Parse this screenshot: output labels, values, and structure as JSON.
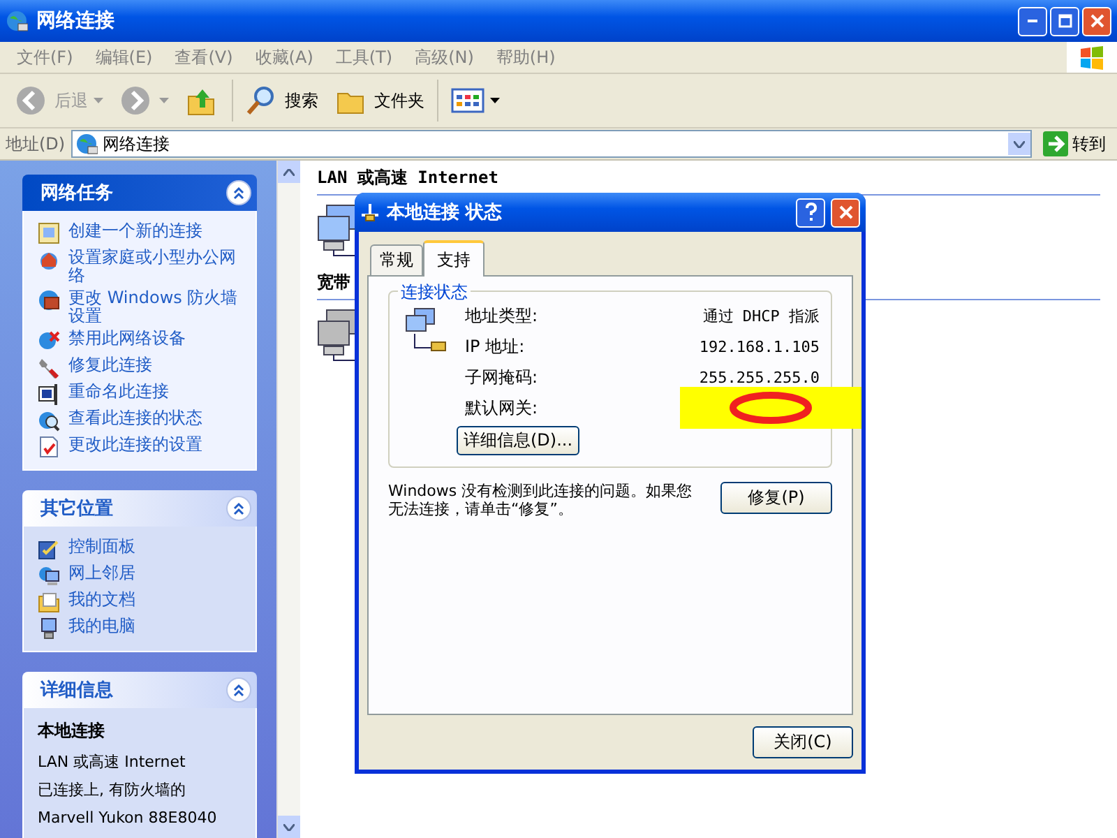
{
  "window": {
    "title": "网络连接"
  },
  "menu": [
    {
      "label": "文件(F)"
    },
    {
      "label": "编辑(E)"
    },
    {
      "label": "查看(V)"
    },
    {
      "label": "收藏(A)"
    },
    {
      "label": "工具(T)"
    },
    {
      "label": "高级(N)"
    },
    {
      "label": "帮助(H)"
    }
  ],
  "toolbar": [
    {
      "kind": "back",
      "label": "后退",
      "disabled": true
    },
    {
      "kind": "forward",
      "disabled": true
    },
    {
      "kind": "up"
    },
    {
      "kind": "search",
      "label": "搜索"
    },
    {
      "kind": "folders",
      "label": "文件夹"
    },
    {
      "kind": "views"
    }
  ],
  "address_bar": {
    "label": "地址(D)",
    "value": "网络连接",
    "go": "转到"
  },
  "task_panels": [
    {
      "kind": "primary",
      "title": "网络任务",
      "expanded": true,
      "items": [
        {
          "label": "创建一个新的连接"
        },
        {
          "label": "设置家庭或小型办公网络"
        },
        {
          "label": "更改 Windows 防火墙设置"
        },
        {
          "label": "禁用此网络设备"
        },
        {
          "label": "修复此连接"
        },
        {
          "label": "重命名此连接"
        },
        {
          "label": "查看此连接的状态"
        },
        {
          "label": "更改此连接的设置"
        }
      ]
    },
    {
      "kind": "normal",
      "title": "其它位置",
      "expanded": true,
      "items": [
        {
          "label": "控制面板"
        },
        {
          "label": "网上邻居"
        },
        {
          "label": "我的文档"
        },
        {
          "label": "我的电脑"
        }
      ]
    },
    {
      "kind": "details",
      "title": "详细信息",
      "expanded": true,
      "heading": "本地连接",
      "lines": [
        "LAN 或高速 Internet",
        "已连接上, 有防火墙的",
        "Marvell Yukon 88E8040"
      ]
    }
  ],
  "content": {
    "groups": [
      {
        "title": "LAN 或高速 Internet"
      },
      {
        "title": "宽带"
      }
    ]
  },
  "dialog": {
    "title": "本地连接 状态",
    "tabs": [
      {
        "label": "常规",
        "selected": false
      },
      {
        "label": "支持",
        "selected": true
      }
    ],
    "group_title": "连接状态",
    "fields": [
      {
        "kind": "text",
        "label": "地址类型:",
        "value": "通过 DHCP 指派"
      },
      {
        "kind": "text",
        "label": "IP 地址:",
        "value": "192.168.1.105"
      },
      {
        "kind": "text",
        "label": "子网掩码:",
        "value": "255.255.255.0"
      },
      {
        "kind": "redacted",
        "label": "默认网关:"
      }
    ],
    "details_button": "详细信息(D)...",
    "message": "Windows 没有检测到此连接的问题。如果您无法连接，请单击“修复”。",
    "repair_button": "修复(P)",
    "close_button": "关闭(C)"
  }
}
